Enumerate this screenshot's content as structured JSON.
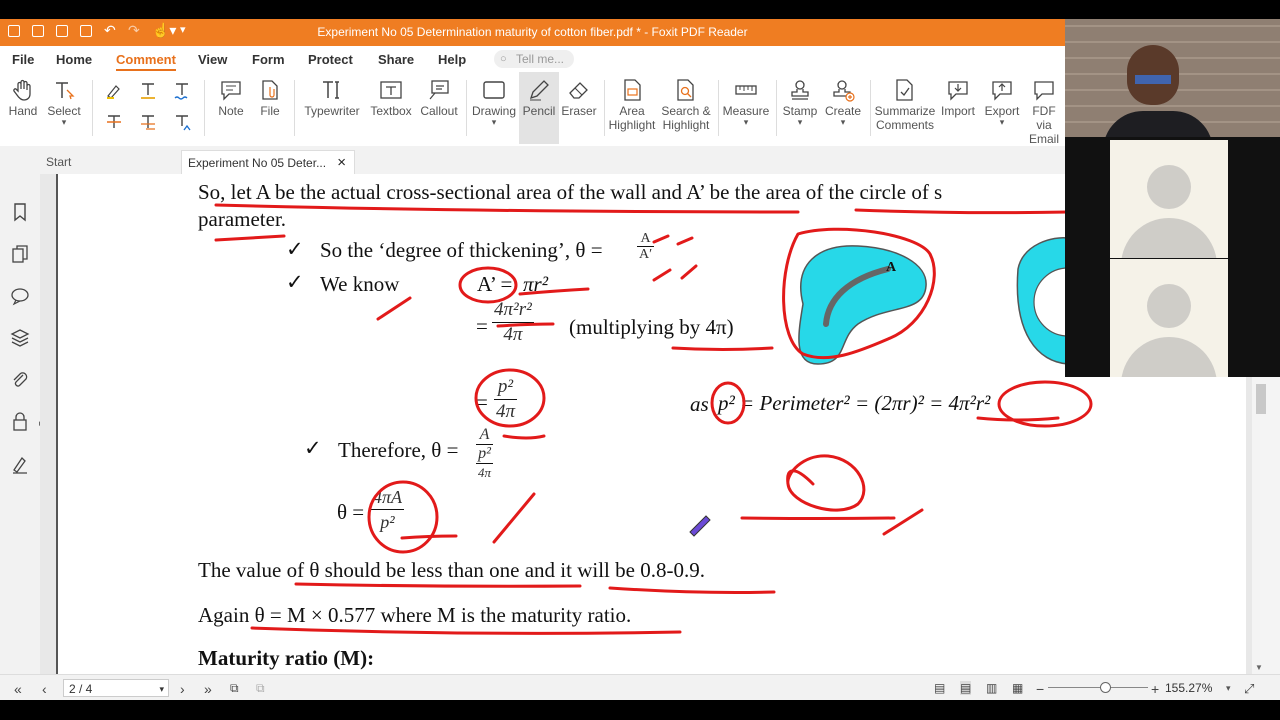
{
  "app": {
    "title": "Experiment No 05 Determination maturity of cotton fiber.pdf * - Foxit PDF Reader"
  },
  "menu": [
    "File",
    "Home",
    "Comment",
    "View",
    "Form",
    "Protect",
    "Share",
    "Help"
  ],
  "menu_active": "Comment",
  "tell_me_placeholder": "Tell me...",
  "ribbon": {
    "hand": "Hand",
    "select": "Select",
    "note": "Note",
    "file": "File",
    "typewriter": "Typewriter",
    "textbox": "Textbox",
    "callout": "Callout",
    "drawing": "Drawing",
    "pencil": "Pencil",
    "eraser": "Eraser",
    "area_highlight_1": "Area",
    "area_highlight_2": "Highlight",
    "search_highlight_1": "Search &",
    "search_highlight_2": "Highlight",
    "measure": "Measure",
    "stamp": "Stamp",
    "create": "Create",
    "summarize_1": "Summarize",
    "summarize_2": "Comments",
    "import": "Import",
    "export": "Export",
    "fdf_1": "FDF via",
    "fdf_2": "Email"
  },
  "tabs": {
    "start": "Start",
    "doc": "Experiment No 05 Deter...",
    "close": "×"
  },
  "doc": {
    "line1": "So, let A be the actual cross-sectional area of the wall and A’ be the area of the circle of s",
    "line2": "parameter.",
    "check": "✓",
    "degree_text": "So the ‘degree of thickening’,  θ =",
    "degree_num": "A",
    "degree_den": "A′",
    "we_know": "We know",
    "a_prime": "A’ =",
    "pi_r2": "πr²",
    "eq": "=",
    "f1_num": "4π²r²",
    "f1_den": "4π",
    "multiplying": "(multiplying  by 4π)",
    "f2_num": "p²",
    "f2_den": "4π",
    "as_text": "as",
    "perimeter_eq": "p² = Perimeter² = (2πr)² = 4π²r²",
    "therefore": "Therefore,  θ =",
    "t_num": "A",
    "t_den_num": "p²",
    "t_den_den": "4π",
    "theta_eq": "θ =",
    "th_num": "4πA",
    "th_den": "p²",
    "value_line": "The value  of θ should  be less  than  one and  it  will  be 0.8-0.9.",
    "again_line": "Again  θ = M × 0.577 where M is the maturity  ratio.",
    "maturity_heading": "Maturity ratio (M):",
    "fig_label": "A"
  },
  "status": {
    "page": "2 / 4",
    "zoom": "155.27%"
  },
  "colors": {
    "accent": "#ef7d22",
    "annotation": "#e21a1a",
    "fiber_fill": "#27d8e8"
  }
}
